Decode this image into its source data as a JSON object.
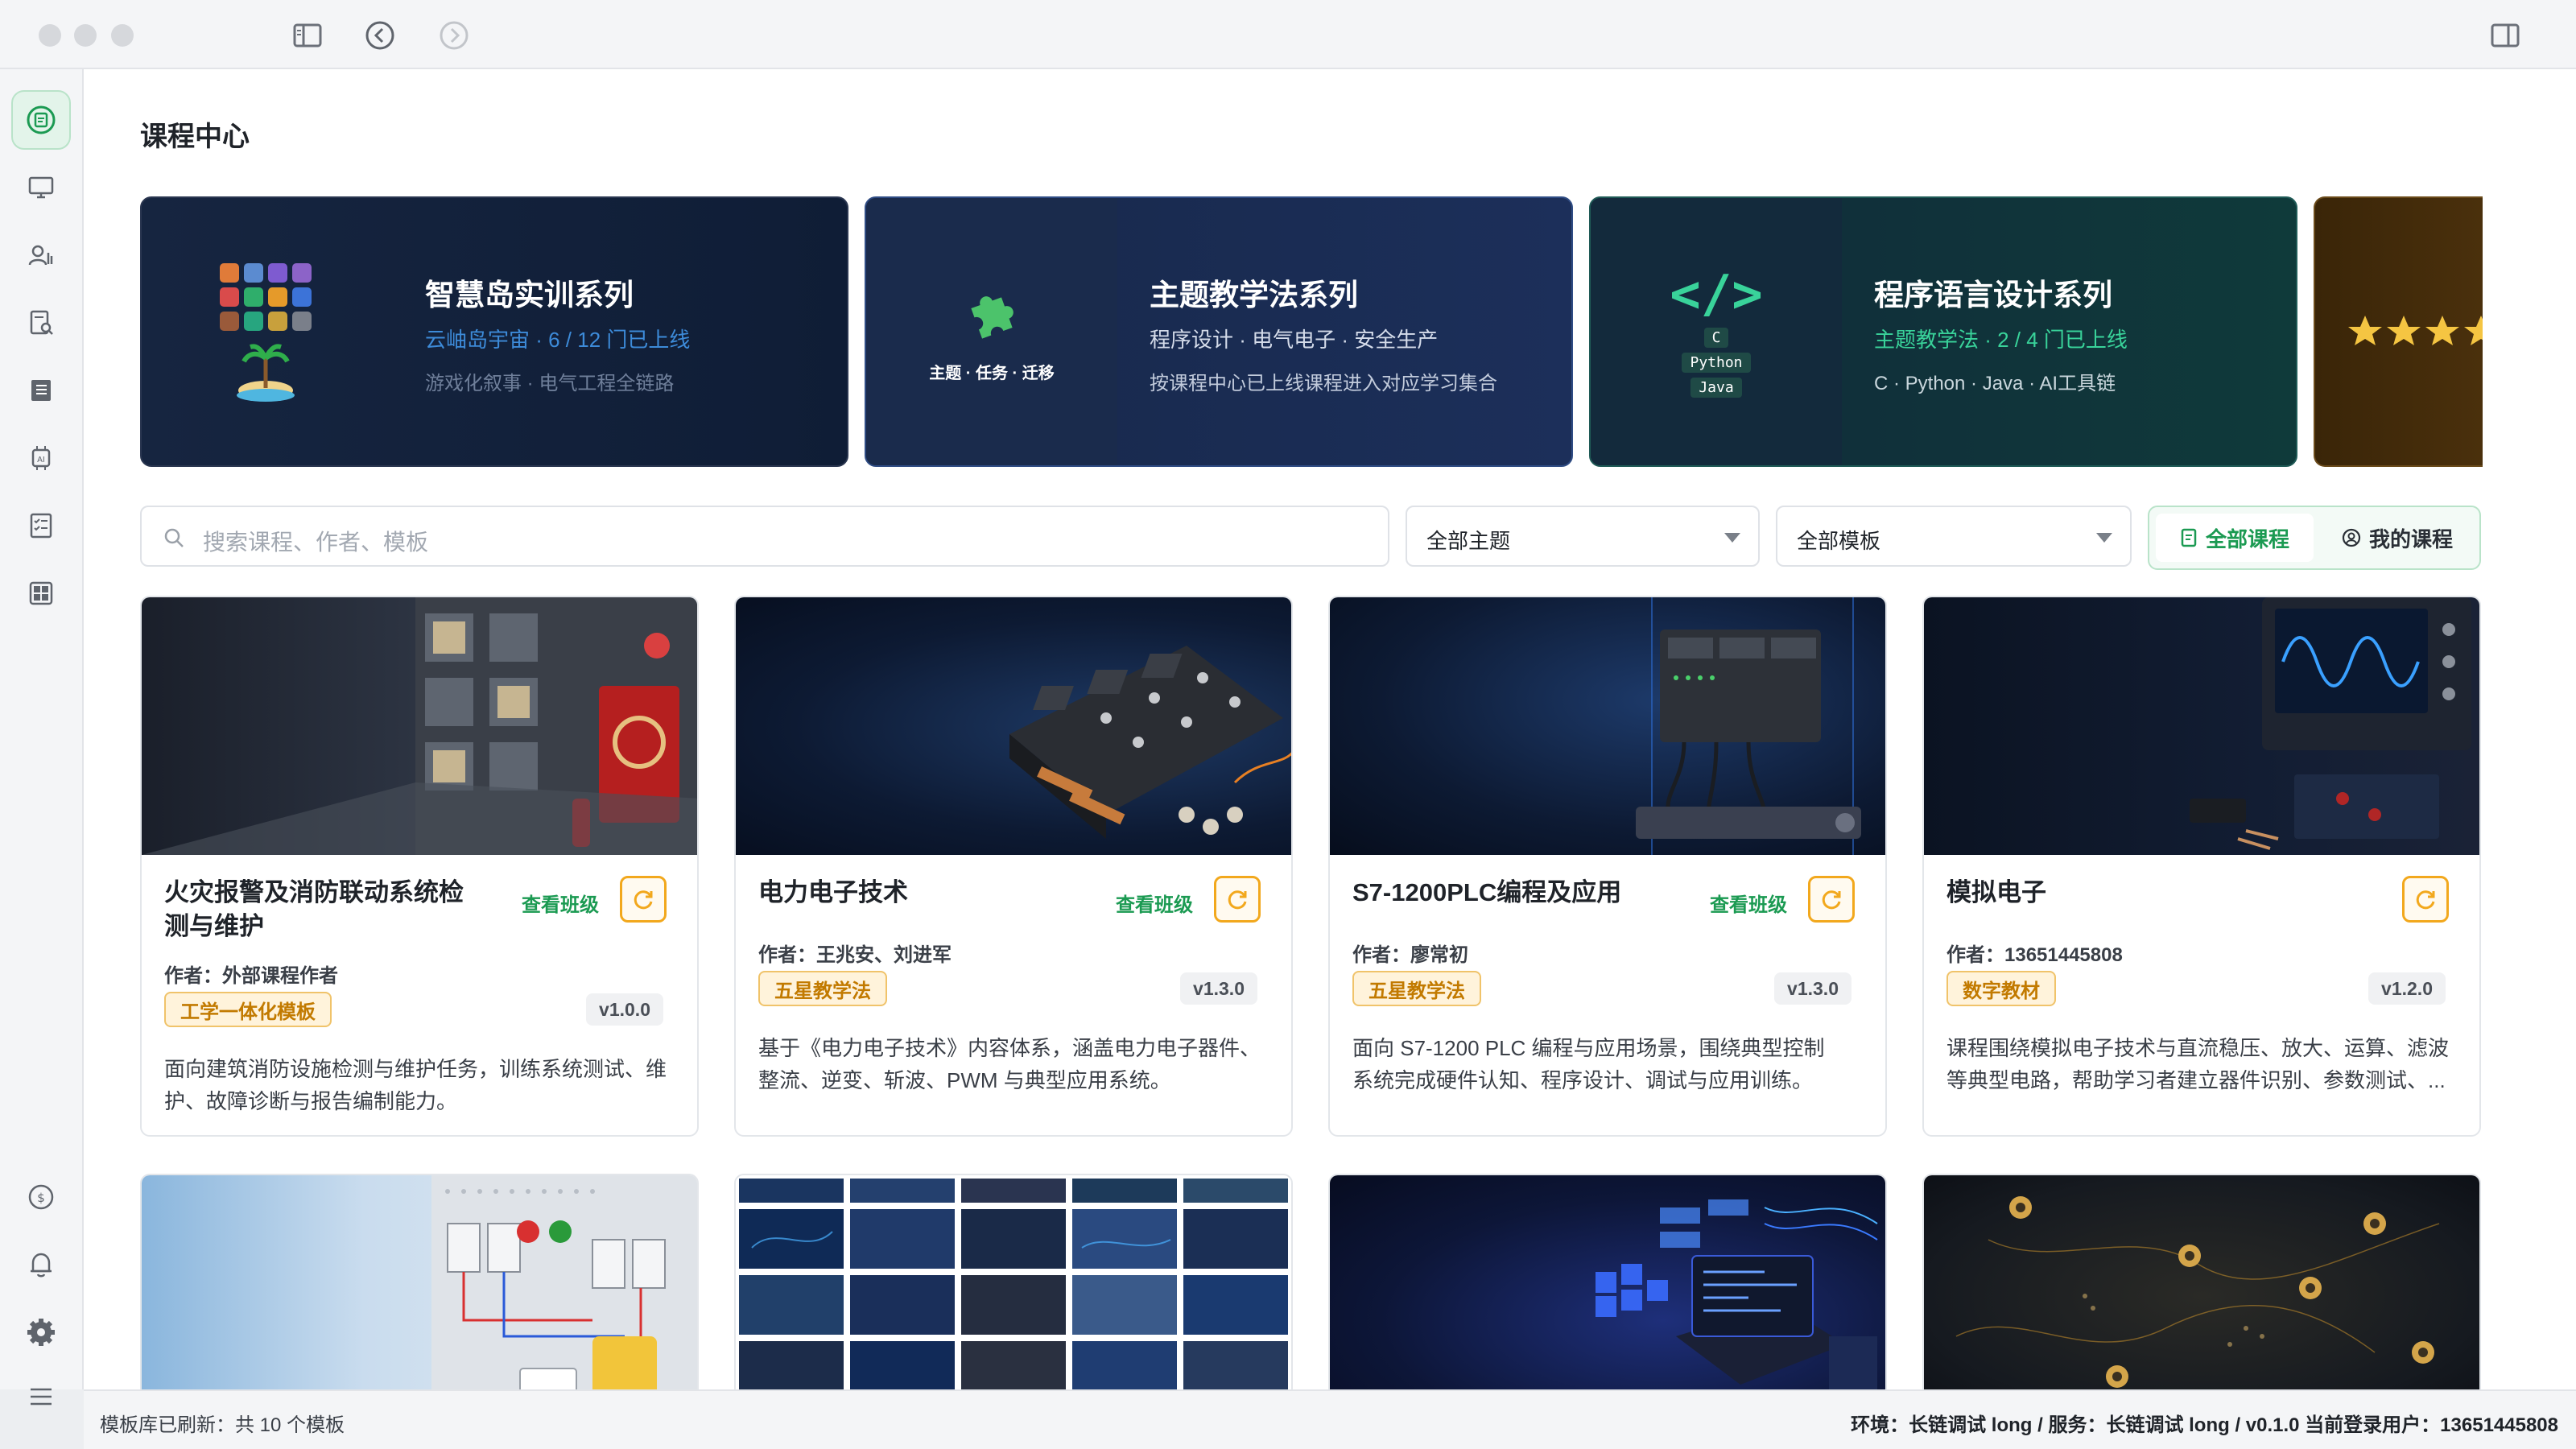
{
  "page": {
    "title": "课程中心"
  },
  "banners": [
    {
      "title": "智慧岛实训系列",
      "subtitle": "云岫岛宇宙 · 6 / 12 门已上线",
      "desc": "游戏化叙事 · 电气工程全链路",
      "accent": "#3d8bd9"
    },
    {
      "title": "主题教学法系列",
      "subtitle": "程序设计 · 电气电子 · 安全生产",
      "desc": "按课程中心已上线课程进入对应学习集合",
      "badge_text": "主题 · 任务 · 迁移",
      "accent": "#ffffff"
    },
    {
      "title": "程序语言设计系列",
      "subtitle": "主题教学法 · 2 / 4 门已上线",
      "desc": "C · Python · Java · AI工具链",
      "code_icon": "</>",
      "langs": [
        "C",
        "Python",
        "Java"
      ],
      "accent": "#39d39a"
    }
  ],
  "search": {
    "placeholder": "搜索课程、作者、模板"
  },
  "filters": {
    "theme": "全部主题",
    "template": "全部模板"
  },
  "segment": {
    "all_label": "全部课程",
    "mine_label": "我的课程"
  },
  "courses": [
    {
      "title_line1": "火灾报警及消防联动系统检",
      "title_line2": "测与维护",
      "view_label": "查看班级",
      "author": "作者：外部课程作者",
      "tag": "工学一体化模板",
      "version": "v1.0.0",
      "desc_line1": "面向建筑消防设施检测与维护任务，训练系统测试、维",
      "desc_line2": "护、故障诊断与报告编制能力。"
    },
    {
      "title_line1": "电力电子技术",
      "view_label": "查看班级",
      "author": "作者：王兆安、刘进军",
      "tag": "五星教学法",
      "version": "v1.3.0",
      "desc_line1": "基于《电力电子技术》内容体系，涵盖电力电子器件、",
      "desc_line2": "整流、逆变、斩波、PWM 与典型应用系统。"
    },
    {
      "title_line1": "S7-1200PLC编程及应用",
      "view_label": "查看班级",
      "author": "作者：廖常初",
      "tag": "五星教学法",
      "version": "v1.3.0",
      "desc_line1": "面向 S7-1200 PLC 编程与应用场景，围绕典型控制",
      "desc_line2": "系统完成硬件认知、程序设计、调试与应用训练。"
    },
    {
      "title_line1": "模拟电子",
      "author": "作者：13651445808",
      "tag": "数字教材",
      "version": "v1.2.0",
      "desc_line1": "课程围绕模拟电子技术与直流稳压、放大、运算、滤波",
      "desc_line2": "等典型电路，帮助学习者建立器件识别、参数测试、..."
    }
  ],
  "status": {
    "left": "模板库已刷新：共 10 个模板",
    "right": "环境：长链调试 long / 服务：长链调试 long / v0.1.0    当前登录用户：13651445808"
  },
  "colors": {
    "brand_green": "#1b9a52",
    "tag_orange": "#c27a00",
    "banner_navy": "#14223d"
  }
}
